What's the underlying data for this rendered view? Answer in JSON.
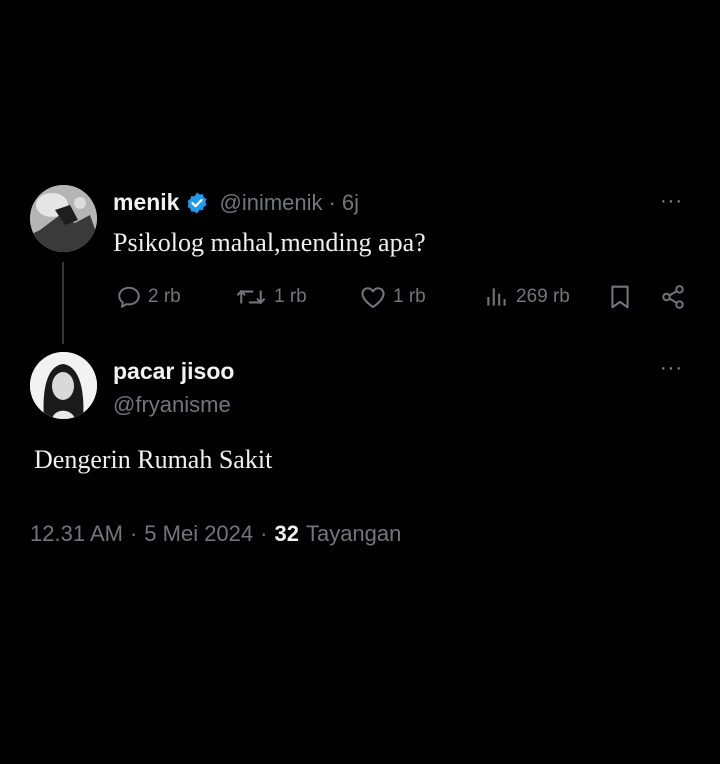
{
  "tweet": {
    "author_name": "menik",
    "handle": "@inimenik",
    "separator": "·",
    "age": "6j",
    "text": "Psikolog mahal,mending apa?",
    "more": "···",
    "actions": {
      "replies": "2 rb",
      "retweets": "1 rb",
      "likes": "1 rb",
      "views": "269 rb"
    },
    "verified": true,
    "verified_color": "#1d9bf0"
  },
  "reply": {
    "author_name": "pacar jisoo",
    "handle": "@fryanisme",
    "text": "Dengerin Rumah Sakit",
    "more": "···",
    "meta": {
      "time": "12.31 AM",
      "sep1": "·",
      "date": "5 Mei 2024",
      "sep2": "·",
      "views_count": "32",
      "views_label": "Tayangan"
    }
  },
  "icons": [
    "reply-icon",
    "retweet-icon",
    "like-icon",
    "views-icon",
    "bookmark-icon",
    "share-icon",
    "verified-badge-icon",
    "more-icon"
  ],
  "colors": {
    "background": "#000000",
    "text": "#e7e9ea",
    "muted": "#71767b"
  }
}
